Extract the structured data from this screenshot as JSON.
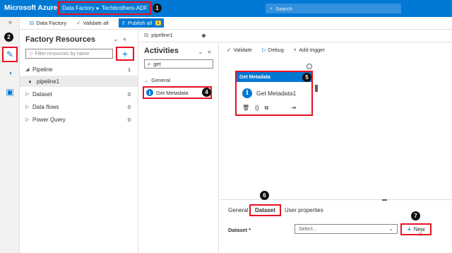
{
  "topbar": {
    "brand": "Microsoft Azure",
    "breadcrumb_service": "Data Factory",
    "breadcrumb_sep": "▸",
    "breadcrumb_factory": "Techbrothers-ADF",
    "search_placeholder": "Search"
  },
  "toolbar": {
    "data_factory": "Data Factory",
    "validate_all": "Validate all",
    "publish_all": "Publish all",
    "publish_count": "1"
  },
  "factory_resources": {
    "title": "Factory Resources",
    "filter_placeholder": "Filter resources by name",
    "add_label": "+",
    "items": [
      {
        "label": "Pipeline",
        "count": "1",
        "expanded": true
      },
      {
        "label": "pipeline1",
        "count": "",
        "child": true
      },
      {
        "label": "Dataset",
        "count": "0"
      },
      {
        "label": "Data flows",
        "count": "0"
      },
      {
        "label": "Power Query",
        "count": "0"
      }
    ]
  },
  "pipeline_tab": {
    "label": "pipeline1"
  },
  "activities": {
    "title": "Activities",
    "search_value": "get",
    "group": "General",
    "item": "Get Metadata"
  },
  "canvas": {
    "validate": "Validate",
    "debug": "Debug",
    "add_trigger": "Add trigger",
    "node": {
      "header": "Get Metadata",
      "name": "Get Metadata1"
    }
  },
  "bottom_panel": {
    "tabs": [
      "General",
      "Dataset",
      "User properties"
    ],
    "active_tab": "Dataset",
    "dataset_label": "Dataset *",
    "select_placeholder": "Select...",
    "new_label": "New"
  },
  "step_badges": [
    "1",
    "2",
    "3",
    "4",
    "5",
    "6",
    "7"
  ],
  "colors": {
    "accent": "#0078d4",
    "highlight": "#e81123",
    "publish_badge": "#ffd335"
  },
  "icons": [
    "search-icon",
    "pencil-icon",
    "monitor-icon",
    "toolbox-icon",
    "filter-icon",
    "pipeline-icon",
    "info-icon",
    "trash-icon",
    "code-icon",
    "copy-icon",
    "arrow-icon"
  ]
}
